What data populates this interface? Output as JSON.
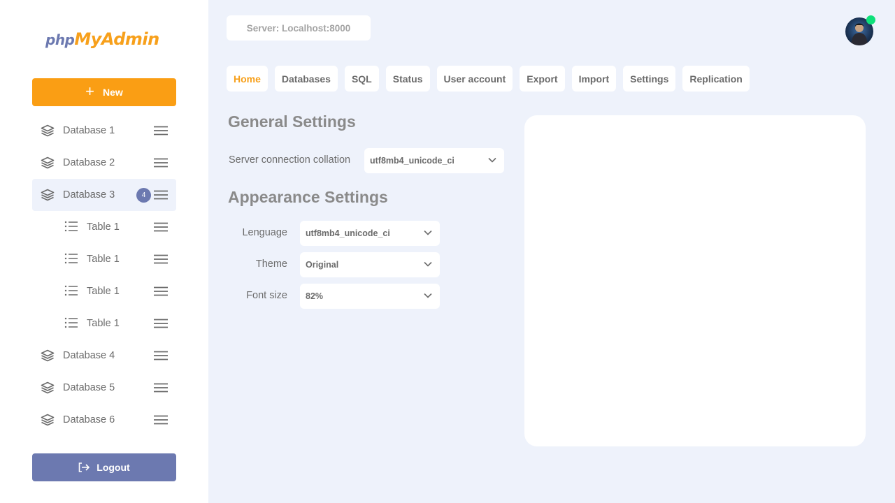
{
  "app": {
    "logo_php": "php",
    "logo_myadmin": "MyAdmin"
  },
  "sidebar": {
    "new_label": "New",
    "logout_label": "Logout",
    "items": [
      {
        "type": "database",
        "label": "Database 1"
      },
      {
        "type": "database",
        "label": "Database 2"
      },
      {
        "type": "database",
        "label": "Database 3",
        "badge": "4",
        "active": true
      },
      {
        "type": "table",
        "label": "Table 1"
      },
      {
        "type": "table",
        "label": "Table 1"
      },
      {
        "type": "table",
        "label": "Table 1"
      },
      {
        "type": "table",
        "label": "Table 1"
      },
      {
        "type": "database",
        "label": "Database 4"
      },
      {
        "type": "database",
        "label": "Database 5"
      },
      {
        "type": "database",
        "label": "Database 6"
      }
    ]
  },
  "header": {
    "server": "Server: Localhost:8000"
  },
  "nav": {
    "tabs": [
      {
        "label": "Home",
        "active": true
      },
      {
        "label": "Databases"
      },
      {
        "label": "SQL"
      },
      {
        "label": "Status"
      },
      {
        "label": "User account"
      },
      {
        "label": "Export"
      },
      {
        "label": "Import"
      },
      {
        "label": "Settings"
      },
      {
        "label": "Replication"
      }
    ]
  },
  "general": {
    "title": "General Settings",
    "collation_label": "Server connection collation",
    "collation_value": "utf8mb4_unicode_ci"
  },
  "appearance": {
    "title": "Appearance Settings",
    "language_label": "Lenguage",
    "language_value": "utf8mb4_unicode_ci",
    "theme_label": "Theme",
    "theme_value": "Original",
    "fontsize_label": "Font size",
    "fontsize_value": "82%"
  },
  "colors": {
    "accent": "#fa9e14",
    "secondary": "#6c79b0",
    "background": "#eef2fb",
    "online": "#0ee07a"
  },
  "icons": {
    "database": "layers-icon",
    "table": "list-icon",
    "menu": "hamburger-icon",
    "new": "plus-icon",
    "logout": "logout-icon",
    "select": "chevron-down-icon"
  }
}
